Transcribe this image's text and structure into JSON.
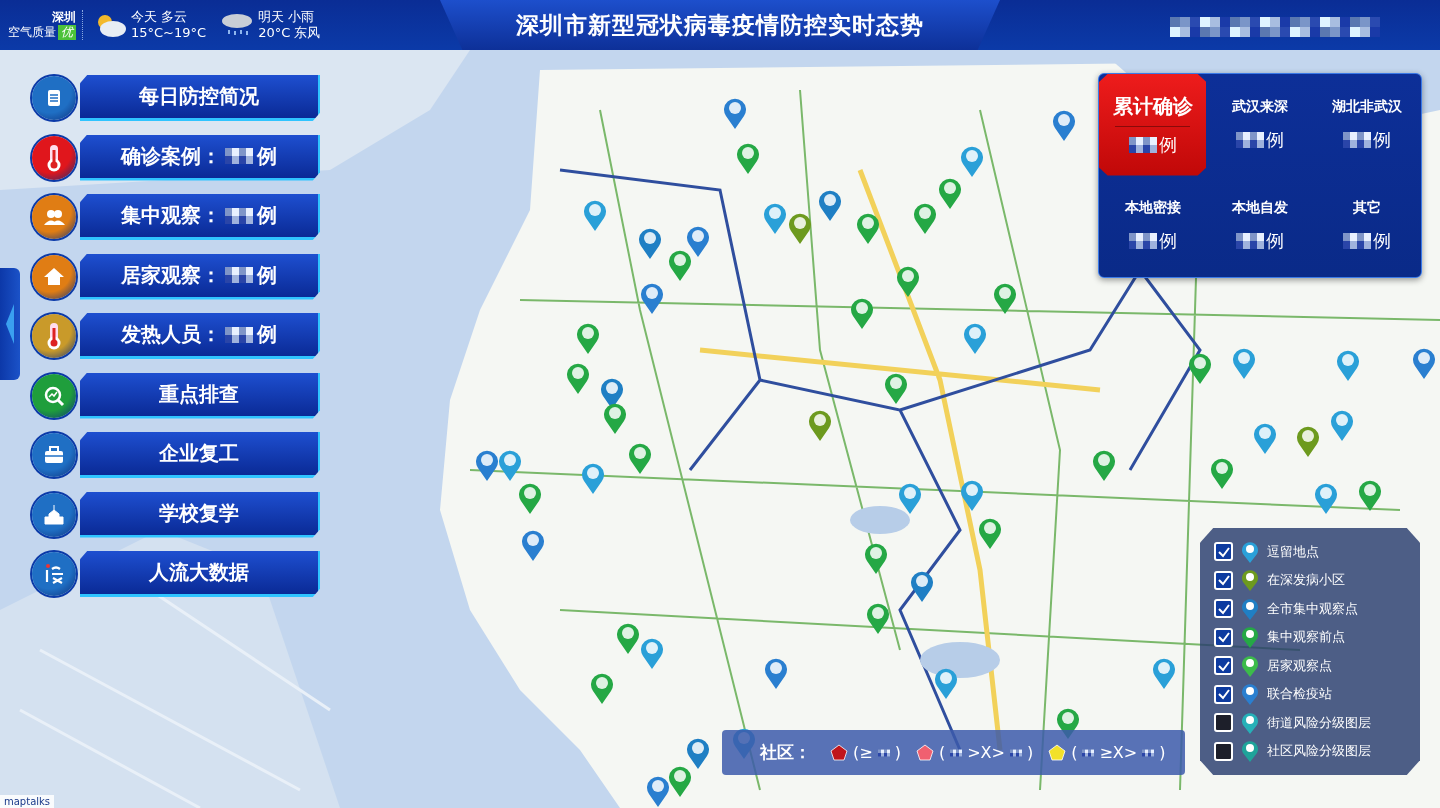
{
  "header": {
    "city": "深圳",
    "air_label": "空气质量",
    "air_grade": "优",
    "weather": [
      {
        "kind": "cloudy",
        "day": "今天",
        "condition": "多云",
        "detail": "15°C~19°C"
      },
      {
        "kind": "rain",
        "day": "明天",
        "condition": "小雨",
        "detail": "20°C 东风"
      }
    ],
    "title": "深圳市新型冠状病毒疫情防控实时态势",
    "user_redacted": true
  },
  "menu": [
    {
      "kind": "report",
      "color": "#1f6fc4",
      "label": "每日防控简况"
    },
    {
      "kind": "thermo",
      "color": "#e0161c",
      "label": "确诊案例：",
      "unit": "例"
    },
    {
      "kind": "people",
      "color": "#e07d14",
      "label": "集中观察：",
      "unit": "例"
    },
    {
      "kind": "home",
      "color": "#e07d14",
      "label": "居家观察：",
      "unit": "例"
    },
    {
      "kind": "thermo",
      "color": "#c99a2a",
      "label": "发热人员：",
      "unit": "例"
    },
    {
      "kind": "search",
      "color": "#1f9e3c",
      "label": "重点排查"
    },
    {
      "kind": "case",
      "color": "#1f6fc4",
      "label": "企业复工"
    },
    {
      "kind": "school",
      "color": "#1f6fc4",
      "label": "学校复学"
    },
    {
      "kind": "flow",
      "color": "#1f6fc4",
      "label": "人流大数据"
    }
  ],
  "stats": [
    {
      "label": "累计确诊",
      "unit": "例",
      "selected": true
    },
    {
      "label": "武汉来深",
      "unit": "例",
      "selected": false
    },
    {
      "label": "湖北非武汉",
      "unit": "例",
      "selected": false
    },
    {
      "label": "本地密接",
      "unit": "例",
      "selected": false
    },
    {
      "label": "本地自发",
      "unit": "例",
      "selected": false
    },
    {
      "label": "其它",
      "unit": "例",
      "selected": false
    }
  ],
  "layers": [
    {
      "label": "逗留地点",
      "checked": true,
      "color": "#2aa0d8"
    },
    {
      "label": "在深发病小区",
      "checked": true,
      "color": "#6d9a1e"
    },
    {
      "label": "全市集中观察点",
      "checked": true,
      "color": "#1f7fc4"
    },
    {
      "label": "集中观察前点",
      "checked": true,
      "color": "#25a845"
    },
    {
      "label": "居家观察点",
      "checked": true,
      "color": "#3cbb4a"
    },
    {
      "label": "联合检疫站",
      "checked": true,
      "color": "#2a7fd0"
    },
    {
      "label": "街道风险分级图层",
      "checked": false,
      "color": "#26b0b8"
    },
    {
      "label": "社区风险分级图层",
      "checked": false,
      "color": "#1fa39a"
    }
  ],
  "community_legend": {
    "label": "社区：",
    "items": [
      {
        "color": "#c0151b",
        "parts": [
          {
            "kind": "text",
            "text": "(≥"
          },
          {
            "kind": "redacted"
          },
          {
            "kind": "text",
            "text": ")"
          }
        ]
      },
      {
        "color": "#f06070",
        "parts": [
          {
            "kind": "text",
            "text": "("
          },
          {
            "kind": "redacted"
          },
          {
            "kind": "text",
            "text": ">X>"
          },
          {
            "kind": "redacted"
          },
          {
            "kind": "text",
            "text": ")"
          }
        ]
      },
      {
        "color": "#f2e12a",
        "parts": [
          {
            "kind": "text",
            "text": "("
          },
          {
            "kind": "redacted"
          },
          {
            "kind": "text",
            "text": "≥X>"
          },
          {
            "kind": "redacted"
          },
          {
            "kind": "text",
            "text": ")"
          }
        ]
      }
    ]
  },
  "map": {
    "kind": "picture",
    "attribution": "maptalks"
  }
}
